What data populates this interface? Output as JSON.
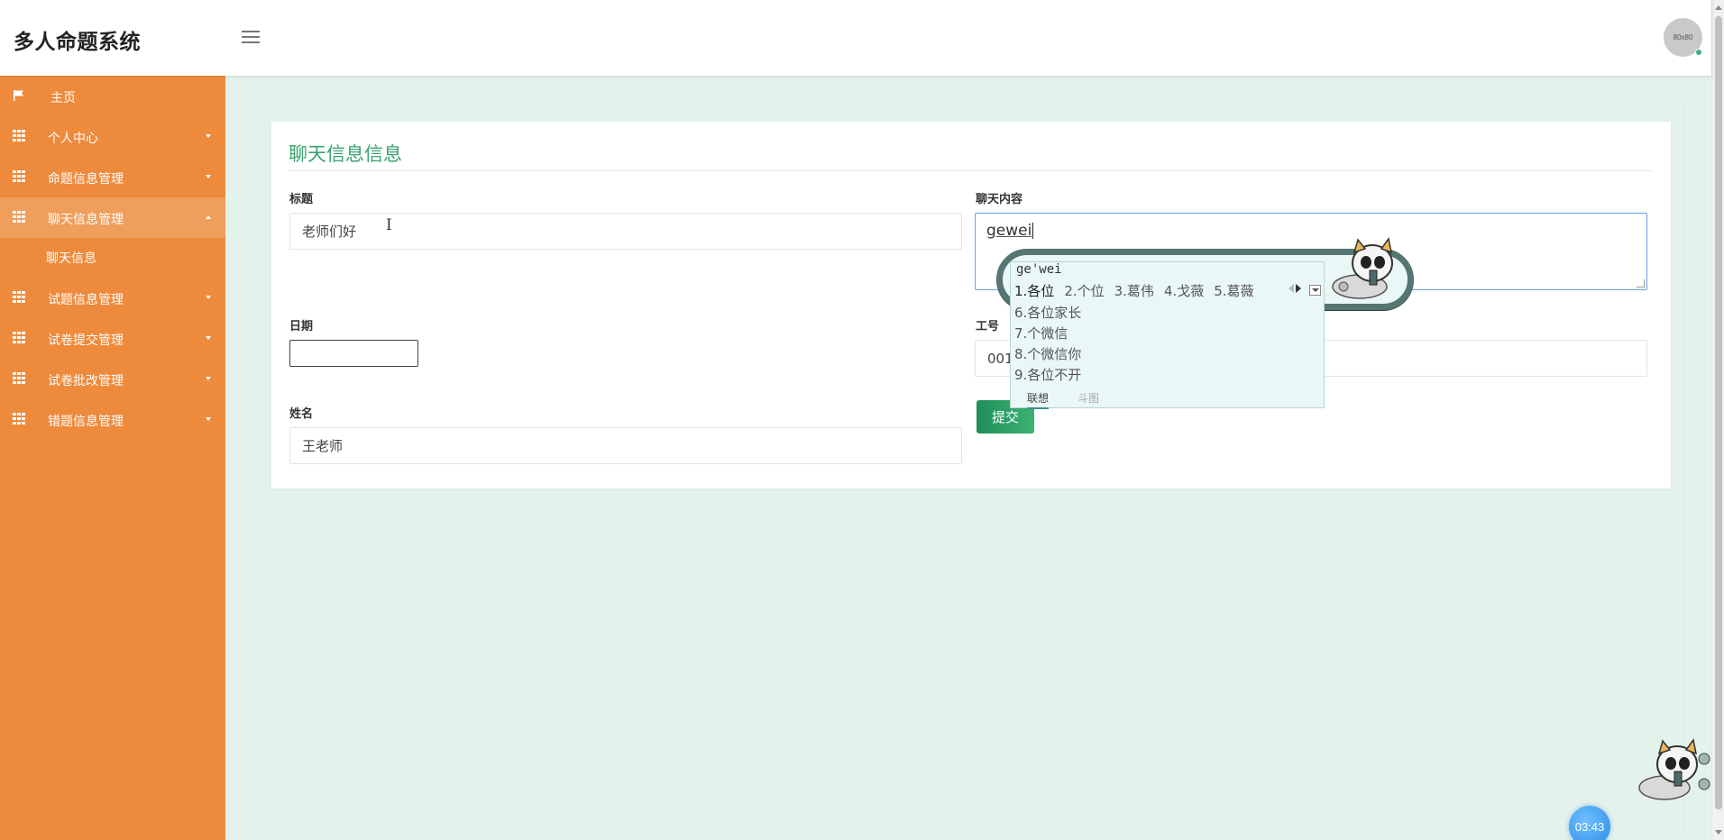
{
  "app": {
    "title": "多人命题系统",
    "avatar_text": "80x80"
  },
  "sidebar": {
    "items": [
      {
        "label": "主页",
        "icon": "flag-icon"
      },
      {
        "label": "个人中心",
        "icon": "grid-icon"
      },
      {
        "label": "命题信息管理",
        "icon": "grid-icon"
      },
      {
        "label": "聊天信息管理",
        "icon": "grid-icon",
        "children": [
          {
            "label": "聊天信息"
          }
        ]
      },
      {
        "label": "试题信息管理",
        "icon": "grid-icon"
      },
      {
        "label": "试卷提交管理",
        "icon": "grid-icon"
      },
      {
        "label": "试卷批改管理",
        "icon": "grid-icon"
      },
      {
        "label": "错题信息管理",
        "icon": "grid-icon"
      }
    ]
  },
  "form": {
    "title": "聊天信息信息",
    "biaoti_label": "标题",
    "biaoti_value": "老师们好",
    "content_label": "聊天内容",
    "content_value": "gewei",
    "date_label": "日期",
    "date_value": "",
    "gonghao_label": "工号",
    "gonghao_value": "001",
    "name_label": "姓名",
    "name_value": "王老师",
    "submit_label": "提交"
  },
  "ime": {
    "pinyin": "ge'wei",
    "candidates": [
      "1.各位",
      "2.个位",
      "3.葛伟",
      "4.戈薇",
      "5.葛薇"
    ],
    "more": [
      "6.各位家长",
      "7.个微信",
      "8.个微信你",
      "9.各位不开"
    ],
    "tabs": [
      "联想",
      "斗图"
    ]
  },
  "timer": "03:43",
  "colors": {
    "sidebar": "#ee8a3c",
    "accent": "#3aa36e",
    "background": "#e4f2ec",
    "submit": "#2a9d62"
  }
}
